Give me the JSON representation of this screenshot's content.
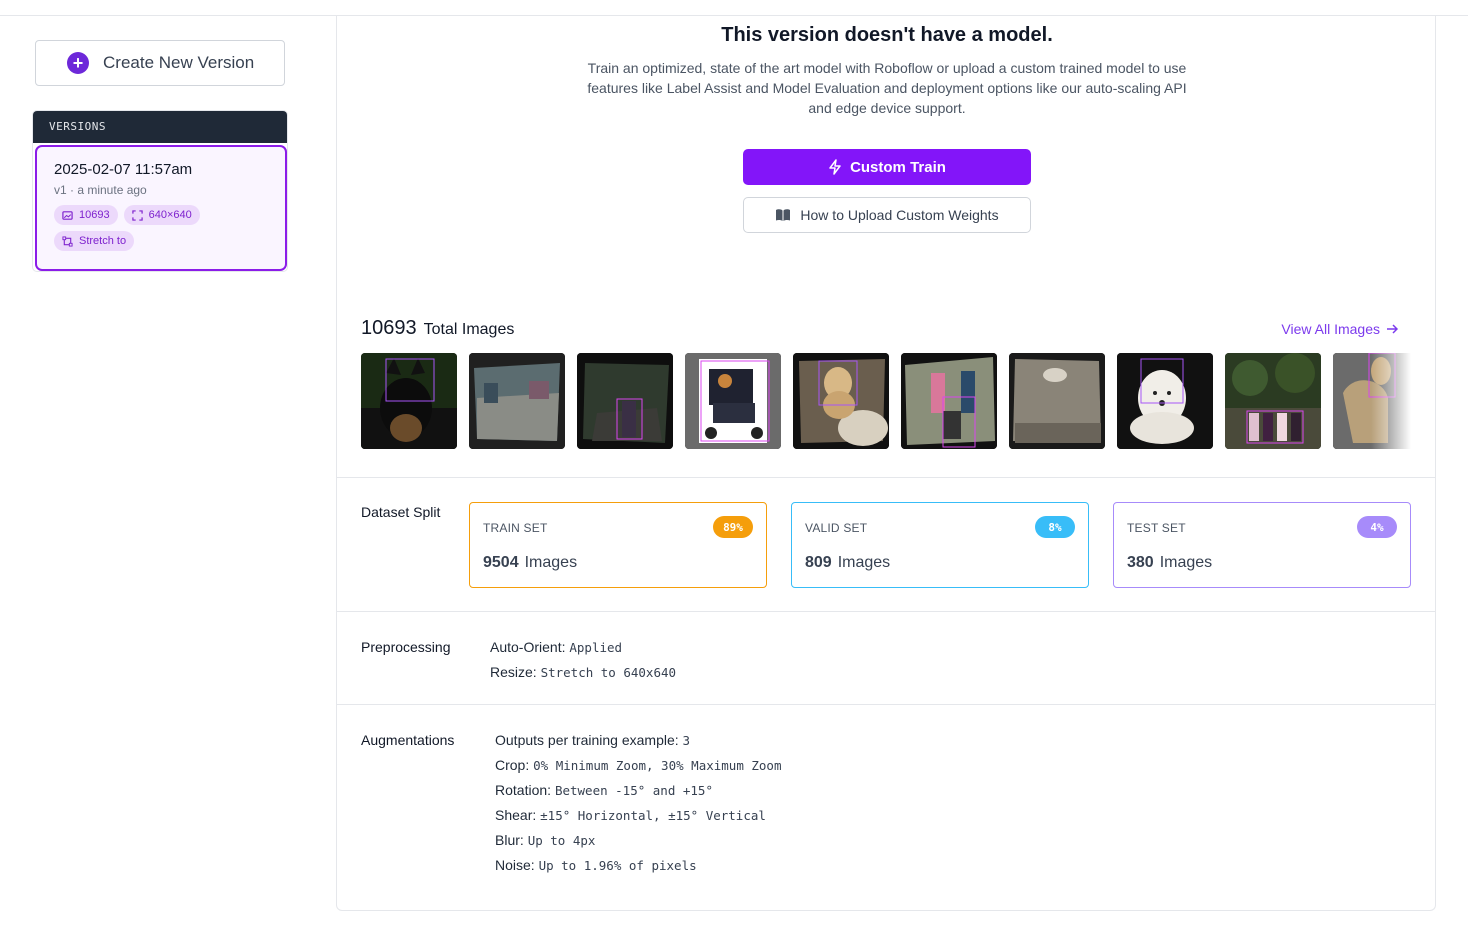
{
  "sidebar": {
    "create_button_label": "Create New Version",
    "versions_header": "VERSIONS",
    "version": {
      "date": "2025-02-07 11:57am",
      "subtitle": "v1 · a minute ago",
      "image_count": "10693",
      "size": "640×640",
      "resize": "Stretch to"
    }
  },
  "main": {
    "title": "This version doesn't have a model.",
    "description": "Train an optimized, state of the art model with Roboflow or upload a custom trained model to use features like Label Assist and Model Evaluation and deployment options like our auto-scaling API and edge device support.",
    "custom_train_label": "Custom Train",
    "upload_weights_label": "How to Upload Custom Weights",
    "total_images": "10693",
    "total_images_label": "Total Images",
    "view_all_label": "View All Images"
  },
  "dataset_split": {
    "label": "Dataset Split",
    "train": {
      "name": "TRAIN SET",
      "pct": "89%",
      "count": "9504",
      "unit": "Images",
      "color": "#f59e0b"
    },
    "valid": {
      "name": "VALID SET",
      "pct": "8%",
      "count": "809",
      "unit": "Images",
      "color": "#38bdf8"
    },
    "test": {
      "name": "TEST SET",
      "pct": "4%",
      "count": "380",
      "unit": "Images",
      "color": "#a78bfa"
    }
  },
  "preprocessing": {
    "label": "Preprocessing",
    "items": [
      {
        "key": "Auto-Orient:",
        "value": "Applied"
      },
      {
        "key": "Resize:",
        "value": "Stretch to 640x640"
      }
    ]
  },
  "augmentations": {
    "label": "Augmentations",
    "items": [
      {
        "key": "Outputs per training example:",
        "value": "3"
      },
      {
        "key": "Crop:",
        "value": "0% Minimum Zoom, 30% Maximum Zoom"
      },
      {
        "key": "Rotation:",
        "value": "Between -15° and +15°"
      },
      {
        "key": "Shear:",
        "value": "±15° Horizontal, ±15° Vertical"
      },
      {
        "key": "Blur:",
        "value": "Up to 4px"
      },
      {
        "key": "Noise:",
        "value": "Up to 1.96% of pixels"
      }
    ]
  },
  "colors": {
    "accent": "#8315f9",
    "sidebar_header": "#1f2937",
    "link": "#7c3aed"
  }
}
